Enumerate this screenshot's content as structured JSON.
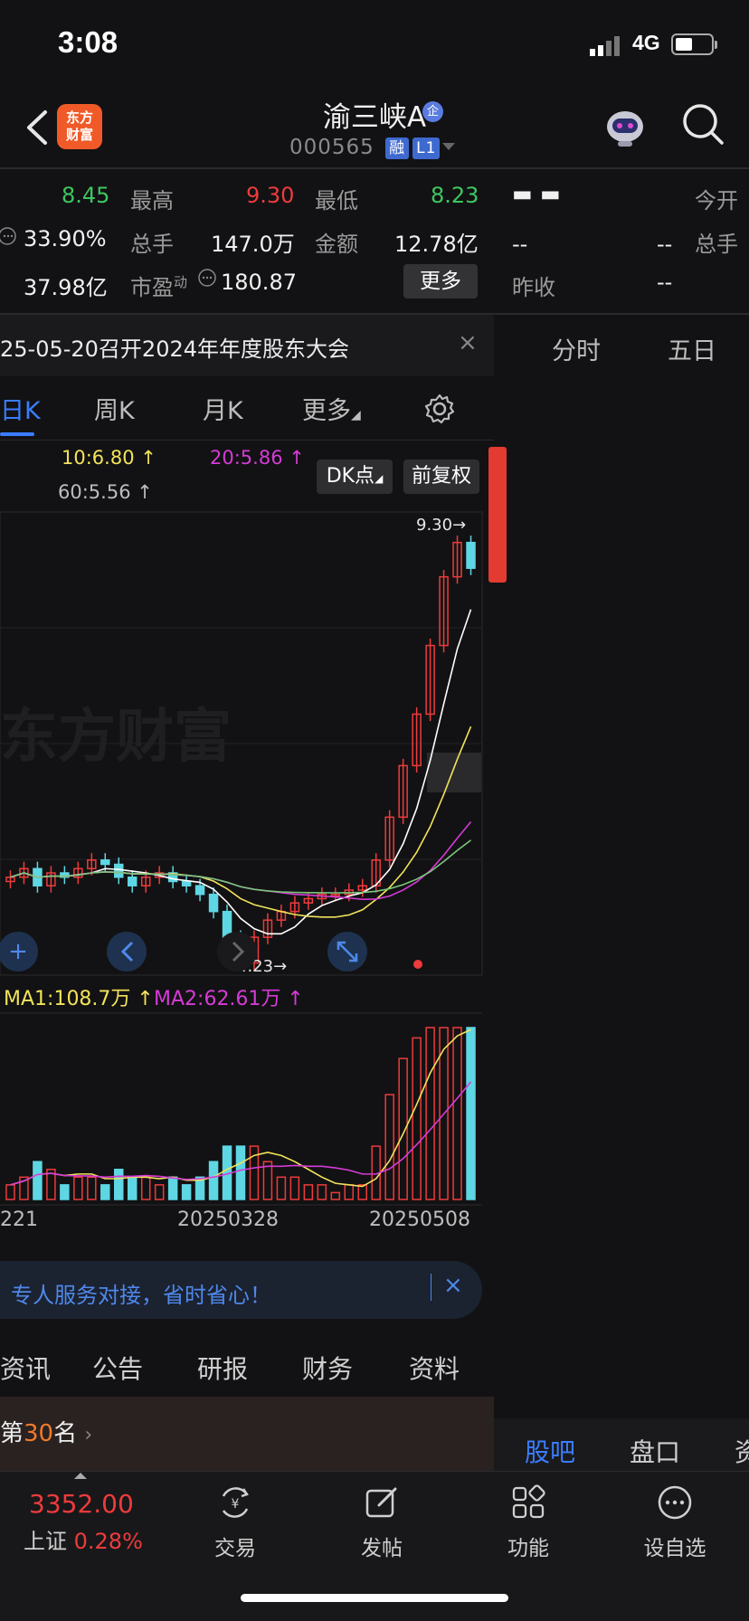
{
  "status_bar": {
    "time": "3:08",
    "network": "4G"
  },
  "header": {
    "logo_text_line1": "东方",
    "logo_text_line2": "财富",
    "stock_name": "渝三峡A",
    "badge": "企",
    "stock_code": "000565",
    "tags": [
      "融",
      "L1"
    ]
  },
  "quote": {
    "row1": {
      "v1": "8.45",
      "high_label": "最高",
      "high": "9.30",
      "low_label": "最低",
      "low": "8.23"
    },
    "row2": {
      "v1": "33.90%",
      "vol_label": "总手",
      "vol": "147.0万",
      "amt_label": "金额",
      "amt": "12.78亿"
    },
    "row3": {
      "v1": "37.98亿",
      "pe_label": "市盈",
      "pe_sup": "动",
      "pe": "180.87",
      "more": "更多"
    },
    "right": {
      "r1_val": "▬ ▬",
      "r1_label": "今开",
      "r2_a": "--",
      "r2_b": "--",
      "r2_label": "总手",
      "r3_label": "昨收",
      "r3_val": "--"
    }
  },
  "notice": {
    "text": "25-05-20召开2024年年度股东大会",
    "close": "×"
  },
  "kline_tabs": [
    "日K",
    "周K",
    "月K",
    "更多"
  ],
  "right_tabs": [
    "分时",
    "五日"
  ],
  "ma": {
    "ma10": "10:6.80 ↑",
    "ma20": "20:5.86 ↑",
    "ma60": "60:5.56 ↑",
    "dk_btn": "DK点",
    "fq_btn": "前复权"
  },
  "chart": {
    "high_mark": "9.30→",
    "low_mark": "4.23→",
    "watermark": "东方财富",
    "vol_ma1": "MA1:108.7万 ↑",
    "vol_ma2": "MA2:62.61万 ↑",
    "x_labels": [
      "221",
      "20250328",
      "20250508"
    ],
    "colors": {
      "up": "#ee3b3b",
      "down": "#5fd6e4",
      "ma5": "#ffffff",
      "ma10": "#f2e35a",
      "ma20": "#d63bd6",
      "ma60": "#7bc67b"
    }
  },
  "chart_data": {
    "type": "candlestick",
    "title": "",
    "xlabel": "",
    "ylabel": "",
    "x_ticks": [
      "221",
      "20250328",
      "20250508"
    ],
    "y_range": [
      4.23,
      9.3
    ],
    "high": 9.3,
    "low": 4.23,
    "close_levels_approx": [
      5.3,
      5.4,
      5.2,
      5.35,
      5.3,
      5.4,
      5.5,
      5.45,
      5.3,
      5.2,
      5.3,
      5.35,
      5.25,
      5.2,
      5.1,
      4.9,
      4.6,
      4.3,
      4.6,
      4.8,
      4.9,
      5.0,
      5.05,
      5.1,
      5.1,
      5.15,
      5.2,
      5.5,
      6.0,
      6.6,
      7.2,
      8.0,
      8.8,
      9.2,
      8.9
    ],
    "series": [
      {
        "name": "MA10",
        "latest": 6.8
      },
      {
        "name": "MA20",
        "latest": 5.86
      },
      {
        "name": "MA60",
        "latest": 5.56
      }
    ],
    "volume": {
      "ma1": "108.7万",
      "ma2": "62.61万"
    }
  },
  "banner": {
    "text": "专人服务对接，省时省心！",
    "close": "×"
  },
  "bottom_tabs": [
    "资讯",
    "公告",
    "研报",
    "财务",
    "资料"
  ],
  "rank": {
    "prefix": "第",
    "num": "30",
    "suffix": "名"
  },
  "right_bottom_tabs": [
    "股吧",
    "盘口",
    "资"
  ],
  "index": {
    "value": "3352.00",
    "name": "上证",
    "change": "0.28%"
  },
  "nav": [
    {
      "label": "交易",
      "icon": "trade-icon"
    },
    {
      "label": "发帖",
      "icon": "post-icon"
    },
    {
      "label": "功能",
      "icon": "grid-icon"
    },
    {
      "label": "设自选",
      "icon": "more-dots-icon"
    }
  ]
}
